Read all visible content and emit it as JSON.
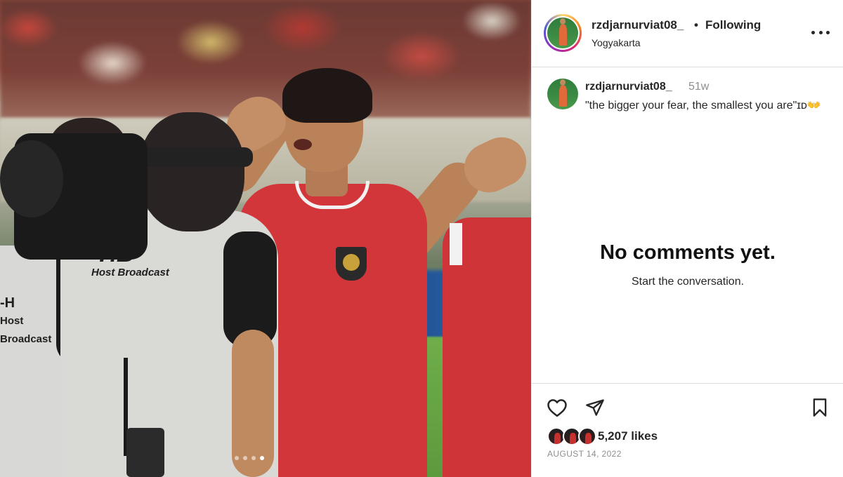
{
  "post": {
    "username": "rzdjarnurviat08_",
    "separator": "•",
    "follow_status": "Following",
    "location": "Yogyakarta",
    "more_icon": "more-horizontal-icon"
  },
  "caption": {
    "username": "rzdjarnurviat08_",
    "time": "51w",
    "text": "\"the bigger your fear, the smallest you are\"ɪᴅ👐"
  },
  "comments": {
    "empty_title": "No comments yet.",
    "empty_subtitle": "Start the conversation."
  },
  "actions": {
    "like_icon": "heart-icon",
    "share_icon": "share-icon",
    "save_icon": "bookmark-icon",
    "likes": "5,207 likes",
    "date": "AUGUST 14, 2022"
  },
  "photo": {
    "jersey_text_front": "",
    "camera_logo": "-HB",
    "camera_logo_sub": "Host Broadcast",
    "left_logo": "-H",
    "left_logo_sub": "Host Broadcast",
    "carousel": {
      "count": 4,
      "active": 4
    }
  },
  "colors": {
    "text_primary": "#262626",
    "text_secondary": "#8e8e8e",
    "divider": "#dbdbdb",
    "jersey_red": "#d3363a"
  }
}
